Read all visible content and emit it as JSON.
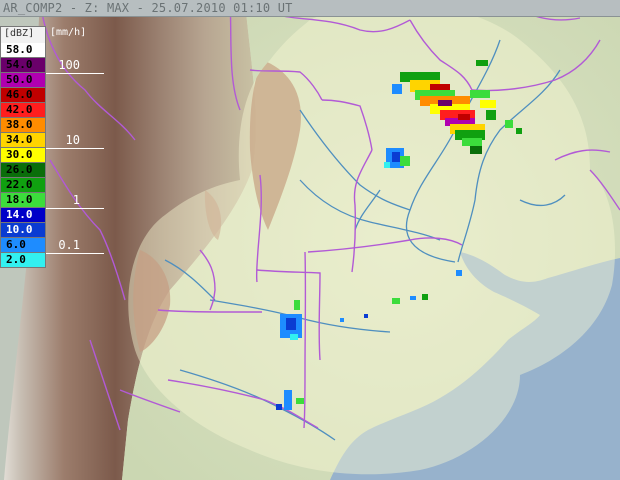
{
  "title": "AR_COMP2 - Z: MAX - 25.07.2010 01:10 UT",
  "legend": {
    "unit_label": "[dBZ]",
    "rate_unit_label": "[mm/h]",
    "levels": [
      {
        "value": "58.0",
        "color": "#ffffff",
        "text_color": "#000000"
      },
      {
        "value": "54.0",
        "color": "#6a006a",
        "text_color": "#000000"
      },
      {
        "value": "50.0",
        "color": "#b000b0",
        "text_color": "#000000"
      },
      {
        "value": "46.0",
        "color": "#c00000",
        "text_color": "#000000"
      },
      {
        "value": "42.0",
        "color": "#ff1e1e",
        "text_color": "#000000"
      },
      {
        "value": "38.0",
        "color": "#ff8c00",
        "text_color": "#000000"
      },
      {
        "value": "34.0",
        "color": "#ffd400",
        "text_color": "#000000"
      },
      {
        "value": "30.0",
        "color": "#ffff00",
        "text_color": "#000000"
      },
      {
        "value": "26.0",
        "color": "#0a6e0a",
        "text_color": "#000000"
      },
      {
        "value": "22.0",
        "color": "#10a010",
        "text_color": "#000000"
      },
      {
        "value": "18.0",
        "color": "#3cdc3c",
        "text_color": "#000000"
      },
      {
        "value": "14.0",
        "color": "#0000c8",
        "text_color": "#ffffff"
      },
      {
        "value": "10.0",
        "color": "#0a3cd2",
        "text_color": "#ffffff"
      },
      {
        "value": "6.0",
        "color": "#1e8cff",
        "text_color": "#000000"
      },
      {
        "value": "2.0",
        "color": "#32f0f0",
        "text_color": "#000000"
      }
    ],
    "rain_rates": [
      {
        "label": "100",
        "level_index": 1
      },
      {
        "label": "10",
        "level_index": 6
      },
      {
        "label": "1",
        "level_index": 10
      },
      {
        "label": "0.1",
        "level_index": 13
      }
    ]
  },
  "colors": {
    "ocean": "#97b2cc",
    "land": "#d9e2c7",
    "coverage_mask": "#f4f4d0",
    "mountains": "#9c7d6c",
    "borders": "#b25ad6",
    "rivers": "#4f8fbf",
    "gridlines": "#ffffff"
  },
  "icons": {
    "radar_echo": "radar-echo-clusters"
  }
}
